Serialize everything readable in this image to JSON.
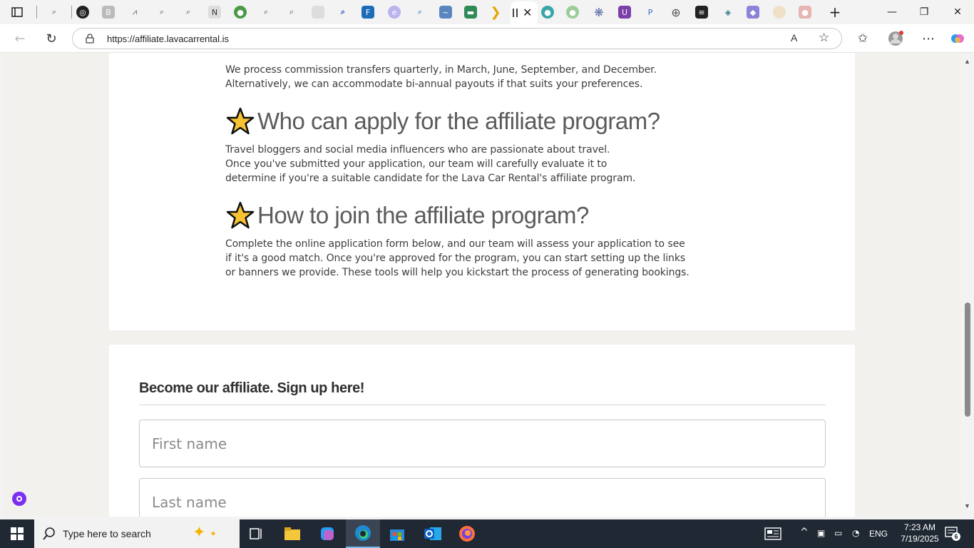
{
  "browser": {
    "url": "https://affiliate.lavacarrental.is",
    "tab_title_fragment": "I",
    "window_controls": {
      "minimize": "—",
      "restore": "❐",
      "close": "✕"
    },
    "new_tab": "+"
  },
  "page": {
    "payout_text": "We process commission transfers quarterly, in March, June, September, and December.\nAlternatively, we can accommodate bi-annual payouts if that suits your preferences.",
    "who_heading": "Who can apply for the affiliate program?",
    "who_text": "Travel bloggers and social media influencers who are passionate about travel.\nOnce you've submitted your application, our team will carefully evaluate it to\ndetermine if you're a suitable candidate for the Lava Car Rental's affiliate program.",
    "join_heading": "How to join the affiliate program?",
    "join_text": "Complete the online application form below, and our team will assess your application to see\nif it's a good match. Once you're approved for the program, you can start setting up the links\nor banners we provide. These tools will help you kickstart the process of generating bookings.",
    "signup_title": "Become our affiliate. Sign up here!",
    "form": {
      "first_name_placeholder": "First name",
      "last_name_placeholder": "Last name"
    }
  },
  "taskbar": {
    "search_placeholder": "Type here to search",
    "language": "ENG",
    "time": "7:23 AM",
    "date": "7/19/2025",
    "notification_count": "6"
  }
}
